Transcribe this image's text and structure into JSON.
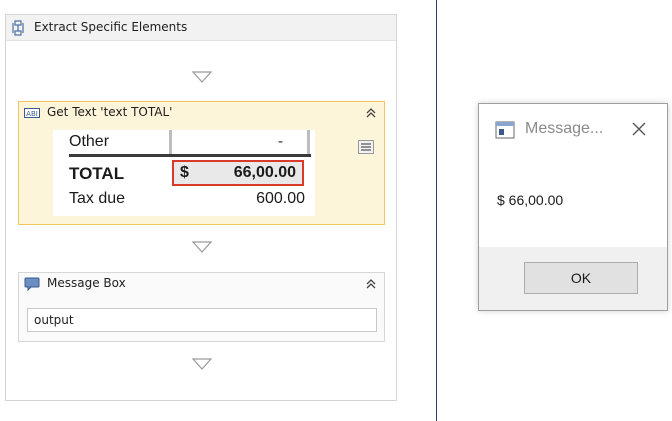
{
  "sequence": {
    "title": "Extract Specific Elements"
  },
  "get_text": {
    "title": "Get Text 'text  TOTAL'",
    "preview": {
      "rows": [
        {
          "label": "Other",
          "value": "-"
        },
        {
          "label": "TOTAL",
          "currency": "$",
          "value": "66,00.00"
        },
        {
          "label": "Tax due",
          "value": "600.00"
        }
      ]
    }
  },
  "message_box_activity": {
    "title": "Message Box",
    "input_value": "output"
  },
  "dialog": {
    "title": "Message...",
    "message": "$ 66,00.00",
    "ok_label": "OK"
  },
  "colors": {
    "selected_header_bg": "#fdf5d9",
    "selected_border": "#f0c75e",
    "selection_highlight": "#d93a2b",
    "divider": "#2c3e6e"
  }
}
